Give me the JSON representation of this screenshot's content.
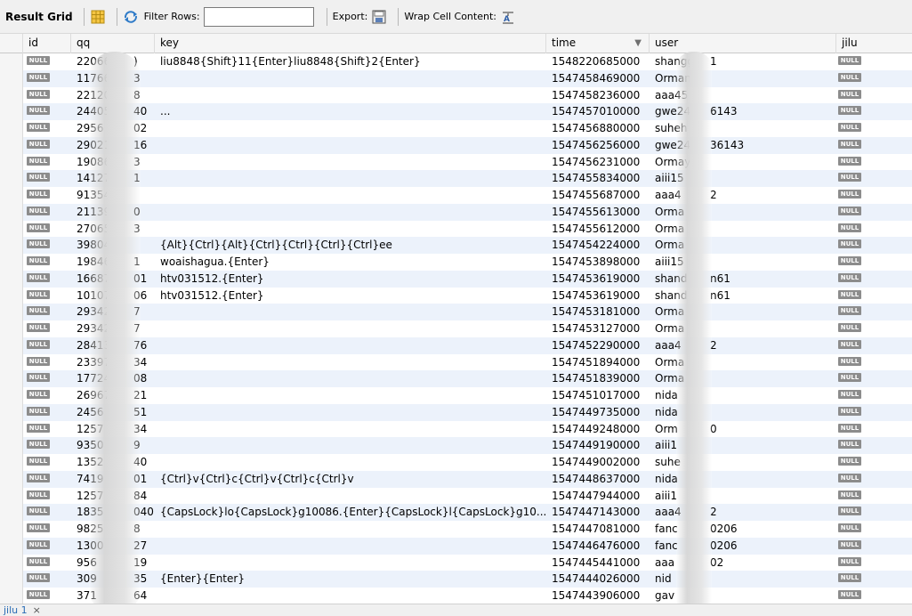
{
  "toolbar": {
    "title": "Result Grid",
    "filter_label": "Filter Rows:",
    "filter_value": "",
    "export_label": "Export:",
    "wrap_label": "Wrap Cell Content:",
    "icons": [
      "grid-icon",
      "refresh-icon",
      "export-icon",
      "wrap-icon"
    ]
  },
  "columns": [
    {
      "label": "id"
    },
    {
      "label": "qq"
    },
    {
      "label": "key"
    },
    {
      "label": "time"
    },
    {
      "label": "user"
    },
    {
      "label": "jilu"
    }
  ],
  "null_text": "NULL",
  "rows": [
    {
      "qq": "22066",
      "qq_end": ")",
      "key": "liu8848{Shift}11{Enter}liu8848{Shift}2{Enter}",
      "time": "1548220685000",
      "user": "shangg",
      "user_end": "1"
    },
    {
      "qq": "11766",
      "qq_end": "3",
      "key": "",
      "time": "1547458469000",
      "user": "Orman",
      "user_end": ""
    },
    {
      "qq": "22120",
      "qq_end": "8",
      "key": "",
      "time": "1547458236000",
      "user": "aaa45",
      "user_end": ""
    },
    {
      "qq": "24405",
      "qq_end": "40",
      "key": "...",
      "time": "1547457010000",
      "user": "gwe24",
      "user_end": "6143"
    },
    {
      "qq": "2956",
      "qq_end": "02",
      "key": "",
      "time": "1547456880000",
      "user": "suheh",
      "user_end": ""
    },
    {
      "qq": "29021",
      "qq_end": "16",
      "key": "",
      "time": "1547456256000",
      "user": "gwe24",
      "user_end": "36143"
    },
    {
      "qq": "19086",
      "qq_end": "3",
      "key": "",
      "time": "1547456231000",
      "user": "Ormay",
      "user_end": ""
    },
    {
      "qq": "14127",
      "qq_end": "1",
      "key": "",
      "time": "1547455834000",
      "user": "aiii15",
      "user_end": ""
    },
    {
      "qq": "91354",
      "qq_end": "",
      "key": "",
      "time": "1547455687000",
      "user": "aaa4",
      "user_end": "2"
    },
    {
      "qq": "21139",
      "qq_end": "0",
      "key": "",
      "time": "1547455613000",
      "user": "Orma",
      "user_end": ""
    },
    {
      "qq": "27065",
      "qq_end": "3",
      "key": "",
      "time": "1547455612000",
      "user": "Orma",
      "user_end": ""
    },
    {
      "qq": "39804",
      "qq_end": "",
      "key": "{Alt}{Ctrl}{Alt}{Ctrl}{Ctrl}{Ctrl}{Ctrl}ee",
      "time": "1547454224000",
      "user": "Orma",
      "user_end": ""
    },
    {
      "qq": "19846",
      "qq_end": "1",
      "key": "woaishagua.{Enter}",
      "time": "1547453898000",
      "user": "aiii15",
      "user_end": ""
    },
    {
      "qq": "16687",
      "qq_end": "01",
      "key": "htv031512.{Enter}",
      "time": "1547453619000",
      "user": "shand",
      "user_end": "n61"
    },
    {
      "qq": "10107",
      "qq_end": "06",
      "key": "htv031512.{Enter}",
      "time": "1547453619000",
      "user": "shand",
      "user_end": "n61"
    },
    {
      "qq": "29342",
      "qq_end": "7",
      "key": "",
      "time": "1547453181000",
      "user": "Orma",
      "user_end": ""
    },
    {
      "qq": "29342",
      "qq_end": "7",
      "key": "",
      "time": "1547453127000",
      "user": "Orma",
      "user_end": ""
    },
    {
      "qq": "28413",
      "qq_end": "76",
      "key": "",
      "time": "1547452290000",
      "user": "aaa4",
      "user_end": "2"
    },
    {
      "qq": "23397",
      "qq_end": "34",
      "key": "",
      "time": "1547451894000",
      "user": "Orma",
      "user_end": ""
    },
    {
      "qq": "17724",
      "qq_end": "08",
      "key": "",
      "time": "1547451839000",
      "user": "Orma",
      "user_end": ""
    },
    {
      "qq": "26967",
      "qq_end": "21",
      "key": "",
      "time": "1547451017000",
      "user": "nida",
      "user_end": ""
    },
    {
      "qq": "2456",
      "qq_end": "51",
      "key": "",
      "time": "1547449735000",
      "user": "nida",
      "user_end": ""
    },
    {
      "qq": "1257",
      "qq_end": "34",
      "key": "",
      "time": "1547449248000",
      "user": "Orm",
      "user_end": "0"
    },
    {
      "qq": "9350",
      "qq_end": "9",
      "key": "",
      "time": "1547449190000",
      "user": "aiii1",
      "user_end": ""
    },
    {
      "qq": "1352",
      "qq_end": "40",
      "key": "",
      "time": "1547449002000",
      "user": "suhe",
      "user_end": ""
    },
    {
      "qq": "7419",
      "qq_end": "01",
      "key": "{Ctrl}v{Ctrl}c{Ctrl}v{Ctrl}c{Ctrl}v",
      "time": "1547448637000",
      "user": "nida",
      "user_end": ""
    },
    {
      "qq": "1257",
      "qq_end": "84",
      "key": "",
      "time": "1547447944000",
      "user": "aiii1",
      "user_end": ""
    },
    {
      "qq": "1835",
      "qq_end": "040",
      "key": "{CapsLock}lo{CapsLock}g10086.{Enter}{CapsLock}l{CapsLock}g10...",
      "time": "1547447143000",
      "user": "aaa4",
      "user_end": "2"
    },
    {
      "qq": "9825",
      "qq_end": "8",
      "key": "",
      "time": "1547447081000",
      "user": "fanc",
      "user_end": "0206"
    },
    {
      "qq": "1300",
      "qq_end": "27",
      "key": "",
      "time": "1547446476000",
      "user": "fanc",
      "user_end": "0206"
    },
    {
      "qq": "956",
      "qq_end": "19",
      "key": "",
      "time": "1547445441000",
      "user": "aaa",
      "user_end": "02"
    },
    {
      "qq": "309",
      "qq_end": "35",
      "key": "{Enter}{Enter}",
      "time": "1547444026000",
      "user": "nid",
      "user_end": ""
    },
    {
      "qq": "371",
      "qq_end": "64",
      "key": "",
      "time": "1547443906000",
      "user": "gav",
      "user_end": ""
    }
  ],
  "bottom_tab": {
    "label": "jilu 1",
    "close": "×"
  }
}
